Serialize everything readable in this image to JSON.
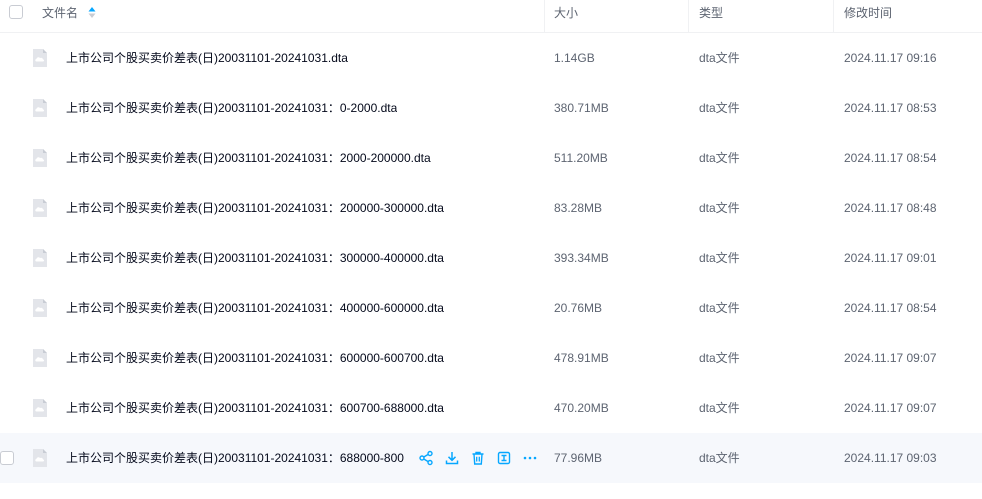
{
  "header": {
    "name_label": "文件名",
    "size_label": "大小",
    "type_label": "类型",
    "mtime_label": "修改时间"
  },
  "colors": {
    "accent": "#06a7ff",
    "text_primary": "#03081a",
    "text_secondary": "#5d6471",
    "hover_row": "#f6f8fc",
    "icon_gray": "#d4d7de"
  },
  "files": [
    {
      "name": "上市公司个股买卖价差表(日)20031101-20241031.dta",
      "size": "1.14GB",
      "type": "dta文件",
      "mtime": "2024.11.17 09:16"
    },
    {
      "name": "上市公司个股买卖价差表(日)20031101-20241031：0-2000.dta",
      "size": "380.71MB",
      "type": "dta文件",
      "mtime": "2024.11.17 08:53"
    },
    {
      "name": "上市公司个股买卖价差表(日)20031101-20241031：2000-200000.dta",
      "size": "511.20MB",
      "type": "dta文件",
      "mtime": "2024.11.17 08:54"
    },
    {
      "name": "上市公司个股买卖价差表(日)20031101-20241031：200000-300000.dta",
      "size": "83.28MB",
      "type": "dta文件",
      "mtime": "2024.11.17 08:48"
    },
    {
      "name": "上市公司个股买卖价差表(日)20031101-20241031：300000-400000.dta",
      "size": "393.34MB",
      "type": "dta文件",
      "mtime": "2024.11.17 09:01"
    },
    {
      "name": "上市公司个股买卖价差表(日)20031101-20241031：400000-600000.dta",
      "size": "20.76MB",
      "type": "dta文件",
      "mtime": "2024.11.17 08:54"
    },
    {
      "name": "上市公司个股买卖价差表(日)20031101-20241031：600000-600700.dta",
      "size": "478.91MB",
      "type": "dta文件",
      "mtime": "2024.11.17 09:07"
    },
    {
      "name": "上市公司个股买卖价差表(日)20031101-20241031：600700-688000.dta",
      "size": "470.20MB",
      "type": "dta文件",
      "mtime": "2024.11.17 09:07"
    },
    {
      "name": "上市公司个股买卖价差表(日)20031101-20241031：688000-800",
      "size": "77.96MB",
      "type": "dta文件",
      "mtime": "2024.11.17 09:03"
    }
  ],
  "row_actions": [
    "share-icon",
    "download-icon",
    "delete-icon",
    "extract-icon",
    "more-icon"
  ]
}
